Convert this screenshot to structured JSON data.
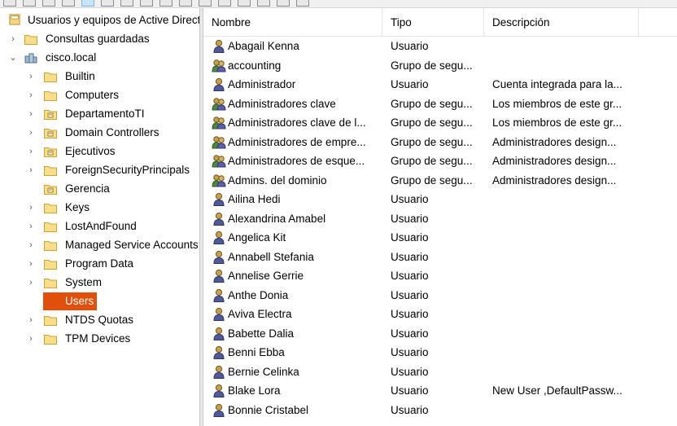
{
  "tree": {
    "root_label": "Usuarios y equipos de Active Directory",
    "saved_queries_label": "Consultas guardadas",
    "domain_label": "cisco.local",
    "children": [
      {
        "label": "Builtin",
        "icon": "folder-icon"
      },
      {
        "label": "Computers",
        "icon": "folder-icon"
      },
      {
        "label": "DepartamentoTI",
        "icon": "ou-folder-icon"
      },
      {
        "label": "Domain Controllers",
        "icon": "ou-folder-icon"
      },
      {
        "label": "Ejecutivos",
        "icon": "ou-folder-icon"
      },
      {
        "label": "ForeignSecurityPrincipals",
        "icon": "folder-icon"
      },
      {
        "label": "Gerencia",
        "icon": "ou-folder-icon"
      },
      {
        "label": "Keys",
        "icon": "folder-icon"
      },
      {
        "label": "LostAndFound",
        "icon": "folder-icon"
      },
      {
        "label": "Managed Service Accounts",
        "icon": "folder-icon"
      },
      {
        "label": "Program Data",
        "icon": "folder-icon"
      },
      {
        "label": "System",
        "icon": "folder-icon"
      },
      {
        "label": "Users",
        "icon": "folder-icon"
      },
      {
        "label": "NTDS Quotas",
        "icon": "folder-icon"
      },
      {
        "label": "TPM Devices",
        "icon": "folder-icon"
      }
    ],
    "selected_label": "Users",
    "selected_color": "#e0500a"
  },
  "list": {
    "columns": [
      "Nombre",
      "Tipo",
      "Descripción"
    ],
    "rows": [
      {
        "name": "Abagail Kenna",
        "type": "Usuario",
        "desc": "",
        "icon": "user-icon"
      },
      {
        "name": "accounting",
        "type": "Grupo de segu...",
        "desc": "",
        "icon": "group-icon"
      },
      {
        "name": "Administrador",
        "type": "Usuario",
        "desc": "Cuenta integrada para la...",
        "icon": "user-icon"
      },
      {
        "name": "Administradores clave",
        "type": "Grupo de segu...",
        "desc": "Los miembros de este gr...",
        "icon": "group-icon"
      },
      {
        "name": "Administradores clave de l...",
        "type": "Grupo de segu...",
        "desc": "Los miembros de este gr...",
        "icon": "group-icon"
      },
      {
        "name": "Administradores de empre...",
        "type": "Grupo de segu...",
        "desc": "Administradores design...",
        "icon": "group-icon"
      },
      {
        "name": "Administradores de esque...",
        "type": "Grupo de segu...",
        "desc": "Administradores design...",
        "icon": "group-icon"
      },
      {
        "name": "Admins. del dominio",
        "type": "Grupo de segu...",
        "desc": "Administradores design...",
        "icon": "group-icon"
      },
      {
        "name": "Ailina Hedi",
        "type": "Usuario",
        "desc": "",
        "icon": "user-icon"
      },
      {
        "name": "Alexandrina Amabel",
        "type": "Usuario",
        "desc": "",
        "icon": "user-icon"
      },
      {
        "name": "Angelica Kit",
        "type": "Usuario",
        "desc": "",
        "icon": "user-icon"
      },
      {
        "name": "Annabell Stefania",
        "type": "Usuario",
        "desc": "",
        "icon": "user-icon"
      },
      {
        "name": "Annelise Gerrie",
        "type": "Usuario",
        "desc": "",
        "icon": "user-icon"
      },
      {
        "name": "Anthe Donia",
        "type": "Usuario",
        "desc": "",
        "icon": "user-icon"
      },
      {
        "name": "Aviva Electra",
        "type": "Usuario",
        "desc": "",
        "icon": "user-icon"
      },
      {
        "name": "Babette Dalia",
        "type": "Usuario",
        "desc": "",
        "icon": "user-icon"
      },
      {
        "name": "Benni Ebba",
        "type": "Usuario",
        "desc": "",
        "icon": "user-icon"
      },
      {
        "name": "Bernie Celinka",
        "type": "Usuario",
        "desc": "",
        "icon": "user-icon"
      },
      {
        "name": "Blake Lora",
        "type": "Usuario",
        "desc": "New User ,DefaultPassw...",
        "icon": "user-icon"
      },
      {
        "name": "Bonnie Cristabel",
        "type": "Usuario",
        "desc": "",
        "icon": "user-icon"
      }
    ]
  }
}
